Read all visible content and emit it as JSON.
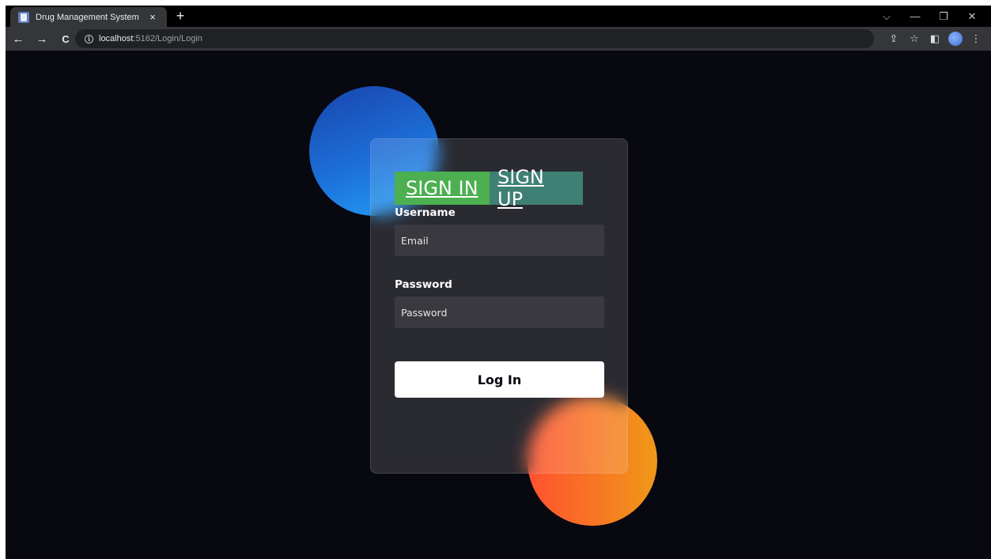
{
  "browser": {
    "tab": {
      "title": "Drug Management System",
      "close_icon": "×"
    },
    "new_tab_icon": "+",
    "window_controls": {
      "tab_search": "⌵",
      "minimize": "—",
      "restore": "❐",
      "close": "✕"
    },
    "nav": {
      "back": "←",
      "forward": "→",
      "reload": "C"
    },
    "url": {
      "info_icon": "i",
      "host": "localhost",
      "path": ":5162/Login/Login"
    },
    "toolbar_icons": {
      "share": "⇪",
      "bookmark": "☆",
      "side_panel": "◧",
      "menu": "⋮"
    }
  },
  "login": {
    "tabs": {
      "sign_in": "SIGN IN",
      "sign_up": "SIGN UP"
    },
    "username_label": "Username",
    "username_placeholder": "Email",
    "password_label": "Password",
    "password_placeholder": "Password",
    "submit_label": "Log In"
  },
  "colors": {
    "page_bg": "#080810",
    "sign_in_bg": "#4caf50",
    "sign_up_bg": "#3f8075",
    "blue_shape": "#1d6fd8",
    "orange_shape": "#ff512f"
  }
}
